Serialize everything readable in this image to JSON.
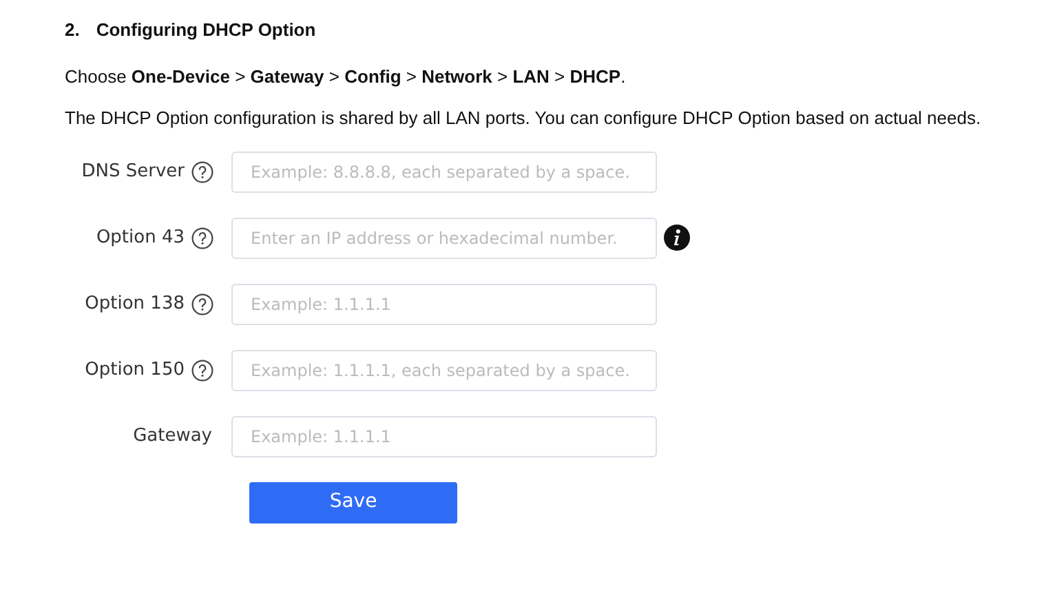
{
  "heading": {
    "number": "2.",
    "title": "Configuring DHCP Option"
  },
  "path": "Choose **One-Device** > **Gateway** > **Config** > **Network** > **LAN** > **DHCP**.",
  "description": "The DHCP Option configuration is shared by all LAN ports. You can configure DHCP Option based on actual needs.",
  "fields": [
    {
      "label": "DNS Server",
      "help": true,
      "placeholder": "Example: 8.8.8.8, each separated by a space.",
      "info": false
    },
    {
      "label": "Option 43",
      "help": true,
      "placeholder": "Enter an IP address or hexadecimal number.",
      "info": true
    },
    {
      "label": "Option 138",
      "help": true,
      "placeholder": "Example: 1.1.1.1",
      "info": false
    },
    {
      "label": "Option 150",
      "help": true,
      "placeholder": "Example: 1.1.1.1, each separated by a space.",
      "info": false
    },
    {
      "label": "Gateway",
      "help": false,
      "placeholder": "Example: 1.1.1.1",
      "info": false
    }
  ],
  "buttons": [
    "Save"
  ]
}
